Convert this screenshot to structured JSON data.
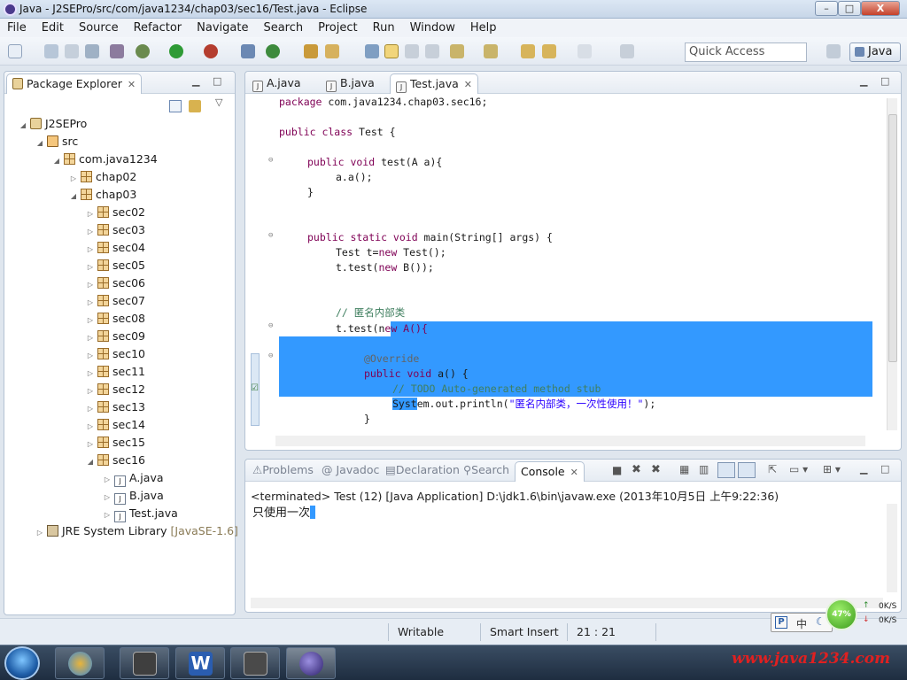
{
  "window": {
    "title": "Java - J2SEPro/src/com/java1234/chap03/sec16/Test.java - Eclipse",
    "min": "–",
    "max": "□",
    "close": "X"
  },
  "menu": [
    "File",
    "Edit",
    "Source",
    "Refactor",
    "Navigate",
    "Search",
    "Project",
    "Run",
    "Window",
    "Help"
  ],
  "toolbar": {
    "quick_access_placeholder": "Quick Access",
    "perspective": "Java"
  },
  "explorer": {
    "title": "Package Explorer",
    "tree": [
      {
        "label": "J2SEPro"
      },
      {
        "label": "src"
      },
      {
        "label": "com.java1234"
      },
      {
        "label": "chap02"
      },
      {
        "label": "chap03"
      },
      {
        "label": "sec02"
      },
      {
        "label": "sec03"
      },
      {
        "label": "sec04"
      },
      {
        "label": "sec05"
      },
      {
        "label": "sec06"
      },
      {
        "label": "sec07"
      },
      {
        "label": "sec08"
      },
      {
        "label": "sec09"
      },
      {
        "label": "sec10"
      },
      {
        "label": "sec11"
      },
      {
        "label": "sec12"
      },
      {
        "label": "sec13"
      },
      {
        "label": "sec14"
      },
      {
        "label": "sec15"
      },
      {
        "label": "sec16"
      },
      {
        "label": "A.java"
      },
      {
        "label": "B.java"
      },
      {
        "label": "Test.java"
      },
      {
        "label": "JRE System Library",
        "suffix": "[JavaSE-1.6]"
      }
    ]
  },
  "editor": {
    "tabs": [
      {
        "label": "A.java",
        "icon": "J"
      },
      {
        "label": "B.java",
        "icon": "J"
      },
      {
        "label": "Test.java",
        "icon": "J",
        "active": true
      }
    ],
    "code": {
      "l1_kw": "package",
      "l1_rest": " com.java1234.chap03.sec16;",
      "l2_kw": "public class",
      "l2_rest": " Test {",
      "l3_kw": "public void",
      "l3_rest": " test(A a){",
      "l4": "a.a();",
      "l5": "}",
      "l6_kw": "public static void",
      "l6_rest": " main(String[] args) {",
      "l7_a": "Test t=",
      "l7_kw": "new",
      "l7_b": " Test();",
      "l8_a": "t.test(",
      "l8_kw": "new",
      "l8_b": " B());",
      "l9": "// 匿名内部类",
      "l10_a": "t.test(n",
      "l10_sel": "ew A(){",
      "l11": "@Override",
      "l12_kw": "public void",
      "l12_rest": " a() {",
      "l13": "// TODO Auto-generated method stub",
      "l14_sel": "Syst",
      "l14_a": "em.out.println(",
      "l14_str": "\"匿名内部类，一次性使用！\"",
      "l14_b": ");",
      "l15": "}"
    }
  },
  "console": {
    "tabs": [
      "Problems",
      "Javadoc",
      "Declaration",
      "Search",
      "Console"
    ],
    "terminated": "<terminated> Test (12) [Java Application] D:\\jdk1.6\\bin\\javaw.exe (2013年10月5日 上午9:22:36)",
    "output": "只使用一次"
  },
  "status": {
    "writable": "Writable",
    "insert_mode": "Smart Insert",
    "position": "21 : 21"
  },
  "ime": {
    "mode": "中"
  },
  "netmon": {
    "percent": "47%",
    "up": "0K/S",
    "down": "0K/S"
  },
  "watermark": "www.java1234.com",
  "colors": {
    "selection": "#3399ff",
    "keyword": "#7f0055",
    "comment": "#3f7f5f",
    "string": "#2a00ff"
  }
}
